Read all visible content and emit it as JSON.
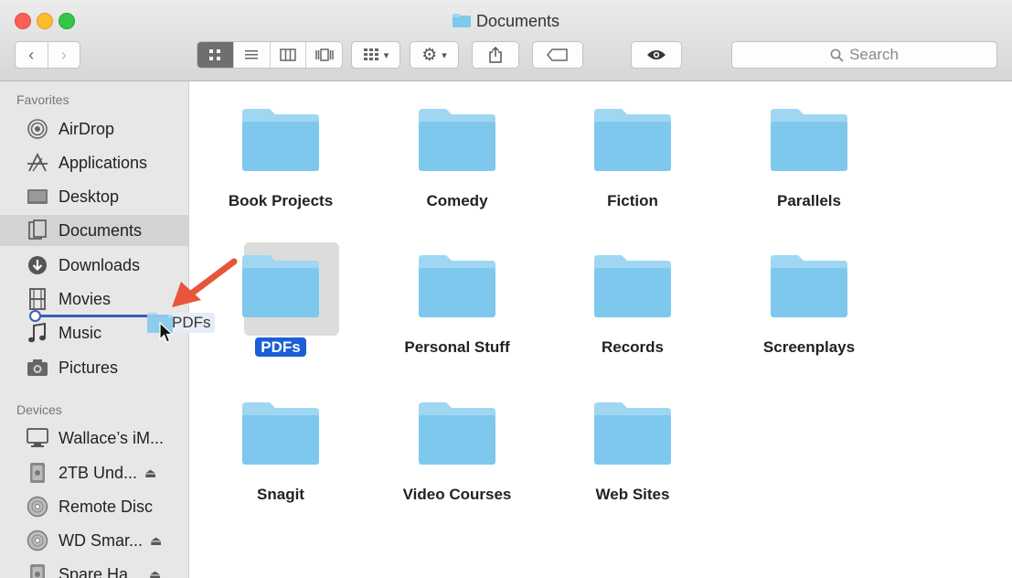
{
  "window": {
    "title": "Documents"
  },
  "toolbar": {
    "search_placeholder": "Search",
    "view_modes": [
      "icon-view",
      "list-view",
      "column-view",
      "cover-flow-view"
    ],
    "active_view": "icon-view"
  },
  "sidebar": {
    "favorites_title": "Favorites",
    "favorites": [
      {
        "label": "AirDrop",
        "icon": "airdrop-icon"
      },
      {
        "label": "Applications",
        "icon": "applications-icon"
      },
      {
        "label": "Desktop",
        "icon": "desktop-icon"
      },
      {
        "label": "Documents",
        "icon": "documents-icon"
      },
      {
        "label": "Downloads",
        "icon": "downloads-icon"
      },
      {
        "label": "Movies",
        "icon": "movies-icon"
      },
      {
        "label": "Music",
        "icon": "music-icon"
      },
      {
        "label": "Pictures",
        "icon": "pictures-icon"
      }
    ],
    "selected": "Documents",
    "devices_title": "Devices",
    "devices": [
      {
        "label": "Wallace’s iM...",
        "icon": "imac-icon"
      },
      {
        "label": "2TB Und...",
        "icon": "drive-icon",
        "eject": "⏏"
      },
      {
        "label": "Remote Disc",
        "icon": "disc-icon"
      },
      {
        "label": "WD Smar...",
        "icon": "disc-icon",
        "eject": "⏏"
      },
      {
        "label": "Spare Ha...",
        "icon": "drive-icon",
        "eject": "⏏"
      }
    ]
  },
  "files": [
    {
      "name": "Book Projects"
    },
    {
      "name": "Comedy"
    },
    {
      "name": "Fiction"
    },
    {
      "name": "Parallels"
    },
    {
      "name": "PDFs",
      "selected": true
    },
    {
      "name": "Personal Stuff"
    },
    {
      "name": "Records"
    },
    {
      "name": "Screenplays"
    },
    {
      "name": "Snagit"
    },
    {
      "name": "Video Courses"
    },
    {
      "name": "Web Sites"
    }
  ],
  "drag": {
    "label": "PDFs"
  },
  "colors": {
    "folder": "#7ec8ee",
    "folder_tab": "#9fd7f3",
    "selection": "#1a5fd6",
    "arrow": "#e8553b",
    "drop_line": "#3b5fb3"
  }
}
